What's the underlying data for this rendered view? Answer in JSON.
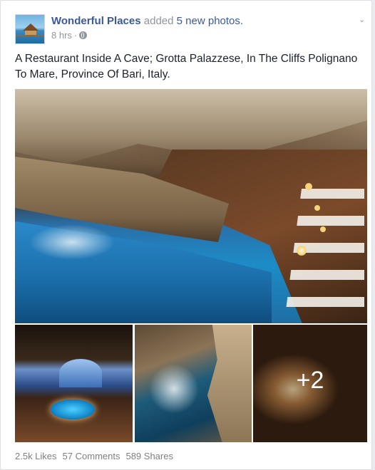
{
  "post": {
    "author": "Wonderful Places",
    "action": "added",
    "photos_link": "5 new photos.",
    "time": "8 hrs",
    "separator": "·",
    "caption": "A Restaurant Inside A Cave; Grotta Palazzese, In The Cliffs Polignano To Mare, Province Of Bari, Italy.",
    "more_photos": "+2"
  },
  "stats": {
    "likes": "2.5k Likes",
    "comments": "57 Comments",
    "shares": "589 Shares"
  },
  "colors": {
    "link": "#3b5998",
    "muted": "#90949c",
    "text": "#1d2129"
  },
  "icons": {
    "privacy": "globe-icon",
    "menu": "chevron-down-icon"
  }
}
